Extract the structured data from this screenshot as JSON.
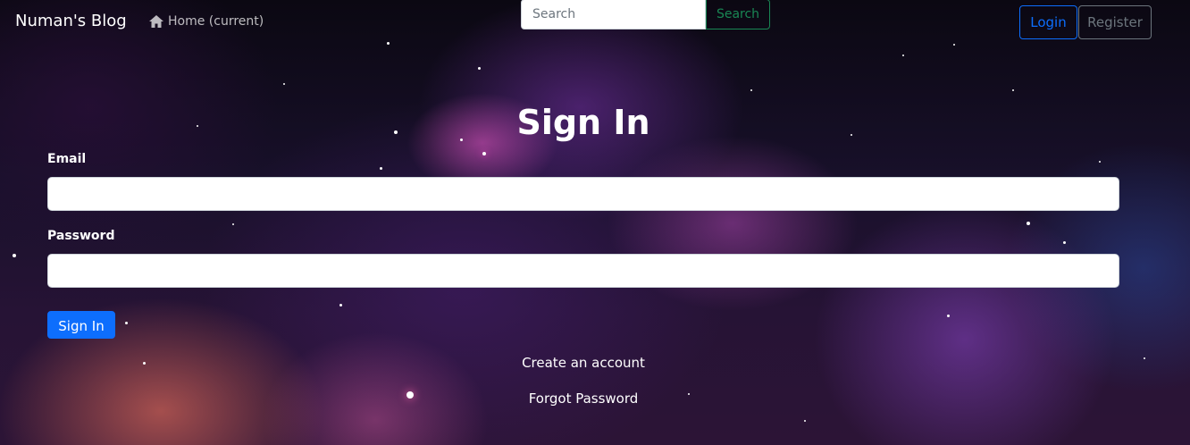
{
  "nav": {
    "brand": "Numan's Blog",
    "home_label": "Home (current)",
    "search": {
      "placeholder": "Search",
      "value": ""
    },
    "search_button": "Search",
    "login_button": "Login",
    "register_button": "Register"
  },
  "form": {
    "title": "Sign In",
    "email_label": "Email",
    "email_value": "",
    "password_label": "Password",
    "password_value": "",
    "submit_label": "Sign In",
    "create_account_link": "Create an account",
    "forgot_password_link": "Forgot Password"
  },
  "colors": {
    "primary": "#0d6efd",
    "success": "#198754",
    "secondary": "#6c757d"
  },
  "icons": {
    "home": "home-icon"
  }
}
